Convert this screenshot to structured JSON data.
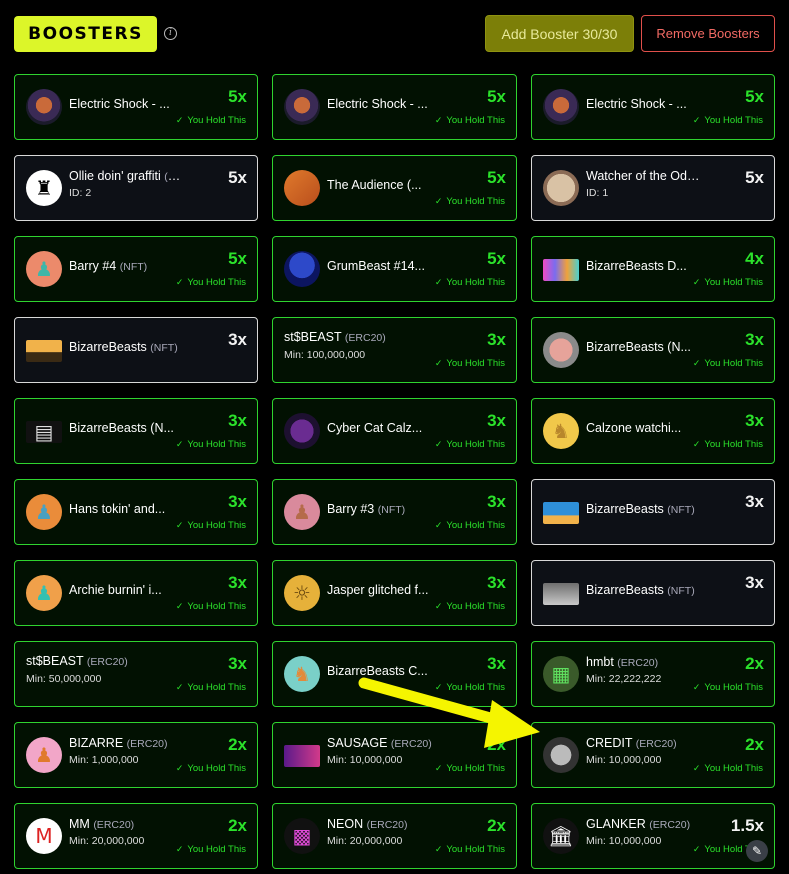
{
  "header": {
    "logo_text": "BOOSTERS",
    "info_symbol": "i",
    "add_button": "Add Booster 30/30",
    "remove_button": "Remove Boosters"
  },
  "hold_text": "You Hold This",
  "check_glyph": "✓",
  "cards": [
    {
      "name": "Electric Shock - ...",
      "type": "",
      "sub": "",
      "mult": "5x",
      "hold": true,
      "style": "green",
      "avatar": "portrait-icon"
    },
    {
      "name": "Electric Shock - ...",
      "type": "",
      "sub": "",
      "mult": "5x",
      "hold": true,
      "style": "green",
      "avatar": "portrait-icon"
    },
    {
      "name": "Electric Shock - ...",
      "type": "",
      "sub": "",
      "mult": "5x",
      "hold": true,
      "style": "green",
      "avatar": "portrait-icon"
    },
    {
      "name": "Ollie doin' graffiti",
      "type": "(NFT)",
      "sub": "ID: 2",
      "mult": "5x",
      "hold": false,
      "style": "white",
      "avatar": "graffiti-icon"
    },
    {
      "name": "The Audience (...",
      "type": "",
      "sub": "",
      "mult": "5x",
      "hold": true,
      "style": "green",
      "avatar": "orange-art-icon"
    },
    {
      "name": "Watcher of the Odd Moo...",
      "type": "",
      "sub": "ID: 1",
      "mult": "5x",
      "hold": false,
      "style": "white",
      "avatar": "face-art-icon"
    },
    {
      "name": "Barry #4",
      "type": "(NFT)",
      "sub": "",
      "mult": "5x",
      "hold": true,
      "style": "green",
      "avatar": "barry-icon"
    },
    {
      "name": "GrumBeast #14...",
      "type": "",
      "sub": "",
      "mult": "5x",
      "hold": true,
      "style": "green",
      "avatar": "grumbeast-icon"
    },
    {
      "name": "BizarreBeasts D...",
      "type": "",
      "sub": "",
      "mult": "4x",
      "hold": true,
      "style": "green",
      "avatar": "colorful-art-icon"
    },
    {
      "name": "BizarreBeasts",
      "type": "(NFT)",
      "sub": "",
      "mult": "3x",
      "hold": false,
      "style": "white",
      "avatar": "landscape-icon"
    },
    {
      "name": "st$BEAST",
      "type": "(ERC20)",
      "sub": "Min: 100,000,000",
      "mult": "3x",
      "hold": true,
      "style": "green",
      "avatar": ""
    },
    {
      "name": "BizarreBeasts (N...",
      "type": "",
      "sub": "",
      "mult": "3x",
      "hold": true,
      "style": "green",
      "avatar": "creature-icon"
    },
    {
      "name": "BizarreBeasts (N...",
      "type": "",
      "sub": "",
      "mult": "3x",
      "hold": true,
      "style": "green",
      "avatar": "sign-icon"
    },
    {
      "name": "Cyber Cat Calz...",
      "type": "",
      "sub": "",
      "mult": "3x",
      "hold": true,
      "style": "green",
      "avatar": "cat-icon"
    },
    {
      "name": "Calzone watchi...",
      "type": "",
      "sub": "",
      "mult": "3x",
      "hold": true,
      "style": "green",
      "avatar": "calzone-icon"
    },
    {
      "name": "Hans tokin' and...",
      "type": "",
      "sub": "",
      "mult": "3x",
      "hold": true,
      "style": "green",
      "avatar": "hans-icon"
    },
    {
      "name": "Barry #3",
      "type": "(NFT)",
      "sub": "",
      "mult": "3x",
      "hold": true,
      "style": "green",
      "avatar": "barry-pink-icon"
    },
    {
      "name": "BizarreBeasts",
      "type": "(NFT)",
      "sub": "",
      "mult": "3x",
      "hold": false,
      "style": "white",
      "avatar": "globe-art-icon"
    },
    {
      "name": "Archie burnin' i...",
      "type": "",
      "sub": "",
      "mult": "3x",
      "hold": true,
      "style": "green",
      "avatar": "archie-icon"
    },
    {
      "name": "Jasper glitched f...",
      "type": "",
      "sub": "",
      "mult": "3x",
      "hold": true,
      "style": "green",
      "avatar": "jasper-icon"
    },
    {
      "name": "BizarreBeasts",
      "type": "(NFT)",
      "sub": "",
      "mult": "3x",
      "hold": false,
      "style": "white",
      "avatar": "grey-art-icon"
    },
    {
      "name": "st$BEAST",
      "type": "(ERC20)",
      "sub": "Min: 50,000,000",
      "mult": "3x",
      "hold": true,
      "style": "green",
      "avatar": ""
    },
    {
      "name": "BizarreBeasts C...",
      "type": "",
      "sub": "",
      "mult": "3x",
      "hold": true,
      "style": "green",
      "avatar": "bb-cat-icon"
    },
    {
      "name": "hmbt",
      "type": "(ERC20)",
      "sub": "Min: 22,222,222",
      "mult": "2x",
      "hold": true,
      "style": "green",
      "avatar": "pixel-icon"
    },
    {
      "name": "BIZARRE",
      "type": "(ERC20)",
      "sub": "Min: 1,000,000",
      "mult": "2x",
      "hold": true,
      "style": "green",
      "avatar": "bizarre-icon"
    },
    {
      "name": "SAUSAGE",
      "type": "(ERC20)",
      "sub": "Min: 10,000,000",
      "mult": "2x",
      "hold": true,
      "style": "green",
      "avatar": "sausage-icon"
    },
    {
      "name": "CREDIT",
      "type": "(ERC20)",
      "sub": "Min: 10,000,000",
      "mult": "2x",
      "hold": true,
      "style": "green",
      "avatar": "credit-icon"
    },
    {
      "name": "MM",
      "type": "(ERC20)",
      "sub": "Min: 20,000,000",
      "mult": "2x",
      "hold": true,
      "style": "green",
      "avatar": "mm-logo-icon"
    },
    {
      "name": "NEON",
      "type": "(ERC20)",
      "sub": "Min: 20,000,000",
      "mult": "2x",
      "hold": true,
      "style": "green",
      "avatar": "neon-icon"
    },
    {
      "name": "GLANKER",
      "type": "(ERC20)",
      "sub": "Min: 10,000,000",
      "mult": "1.5x",
      "hold": true,
      "style": "green",
      "avatar": "bank-icon"
    }
  ],
  "colors": {
    "accent_yellow": "#dcf629",
    "add_button_bg": "#7c7f08",
    "remove_border": "#e0504b",
    "green": "#2be22b",
    "arrow": "#f5f500"
  }
}
